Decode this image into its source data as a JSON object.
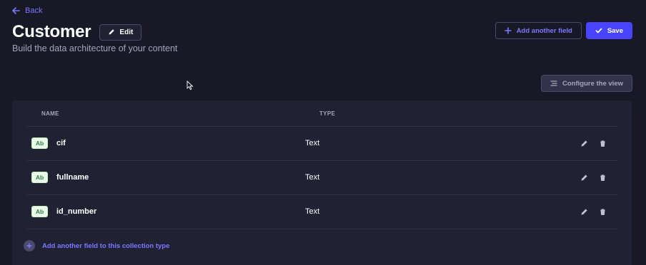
{
  "nav": {
    "back_label": "Back"
  },
  "header": {
    "title": "Customer",
    "edit_label": "Edit",
    "subtitle": "Build the data architecture of your content",
    "add_field_label": "Add another field",
    "save_label": "Save"
  },
  "view": {
    "configure_label": "Configure the view"
  },
  "table": {
    "columns": [
      "NAME",
      "TYPE"
    ],
    "rows": [
      {
        "badge": "Ab",
        "name": "cif",
        "type": "Text"
      },
      {
        "badge": "Ab",
        "name": "fullname",
        "type": "Text"
      },
      {
        "badge": "Ab",
        "name": "id_number",
        "type": "Text"
      }
    ],
    "add_field_label": "Add another field to this collection type"
  },
  "colors": {
    "background": "#181826",
    "card": "#212134",
    "accent": "#4945ff",
    "accent_text": "#7b79ff",
    "badge_bg": "#eafbe7",
    "badge_text": "#328048"
  },
  "icons": {
    "back": "arrow-left-icon",
    "edit": "pencil-icon",
    "add": "plus-icon",
    "save": "check-icon",
    "configure": "list-settings-icon",
    "delete": "trash-icon"
  }
}
